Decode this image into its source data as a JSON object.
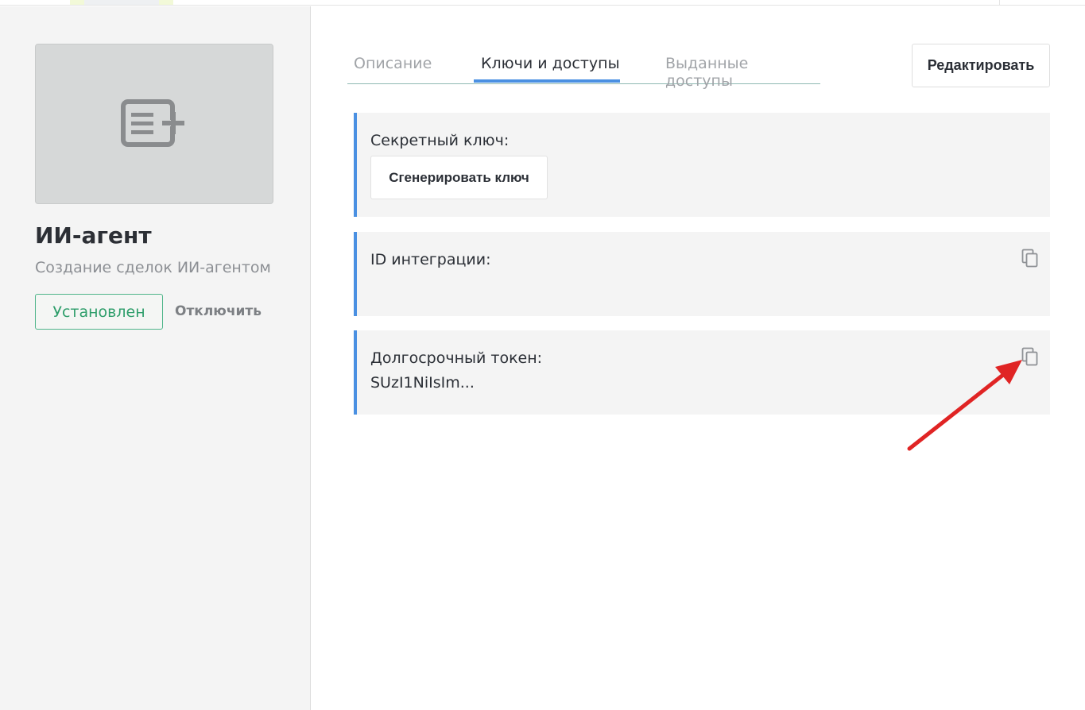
{
  "sidebar": {
    "app_title": "ИИ-агент",
    "app_description": "Создание сделок ИИ-агентом",
    "status_label": "Установлен",
    "disable_label": "Отключить",
    "app_icon": "add-list-icon"
  },
  "tabs": [
    {
      "label": "Описание",
      "active": false
    },
    {
      "label": "Ключи и доступы",
      "active": true
    },
    {
      "label": "Выданные доступы",
      "active": false
    }
  ],
  "toolbar": {
    "edit_label": "Редактировать"
  },
  "fields": {
    "secret_key": {
      "label": "Секретный ключ:",
      "button_label": "Сгенерировать ключ"
    },
    "integration_id": {
      "label": "ID интеграции:",
      "value": ""
    },
    "long_token": {
      "label": "Долгосрочный токен:",
      "value": "SUzI1NiIsIm..."
    }
  },
  "colors": {
    "accent": "#4a90e2",
    "success": "#2e9e6b",
    "annotation_arrow": "#e02424"
  },
  "icons": {
    "copy": "copy-icon"
  }
}
